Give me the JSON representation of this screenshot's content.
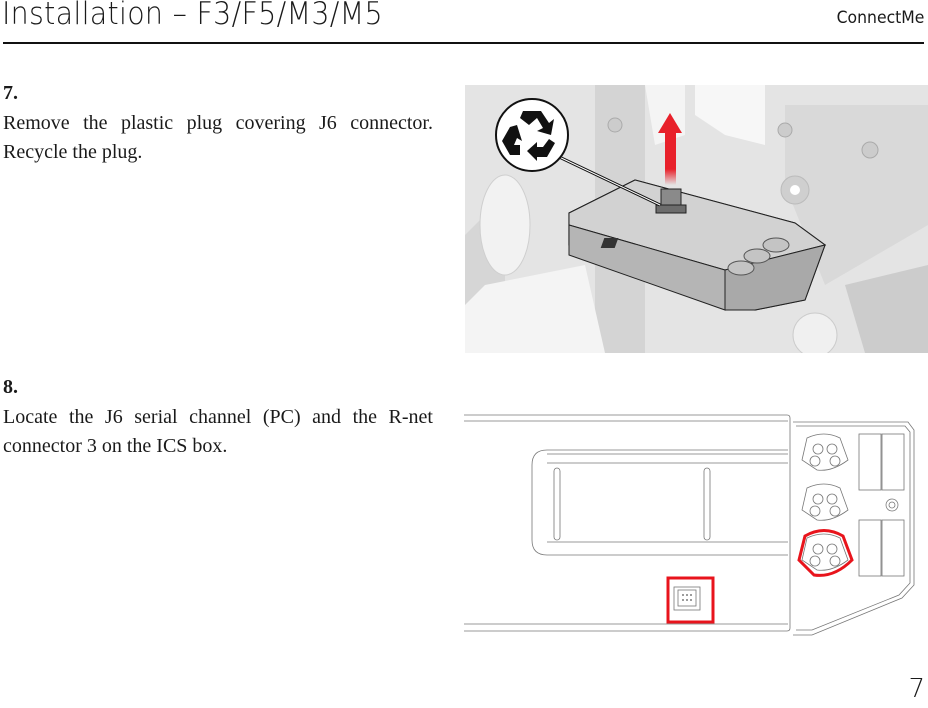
{
  "header": {
    "title": "Installation – F3/F5/M3/M5",
    "brand": "ConnectMe"
  },
  "steps": [
    {
      "number": "7.",
      "text": "Remove the plastic plug covering J6 connector. Recycle the plug.",
      "figure": {
        "description": "ICS box with plastic plug being removed (red arrow up) and recycle symbol callout",
        "icons": [
          "recycle-icon",
          "arrow-up-icon"
        ],
        "accent_color": "#e8202a"
      }
    },
    {
      "number": "8.",
      "text": "Locate the J6 serial channel (PC) and the R-net connector 3 on the ICS box.",
      "figure": {
        "description": "Top view line drawing of ICS box; J6 serial port highlighted with red rectangle, R-net connector 3 highlighted with red rounded outline",
        "highlight_color": "#e8141c"
      }
    }
  ],
  "footer": {
    "page_number": "7"
  }
}
